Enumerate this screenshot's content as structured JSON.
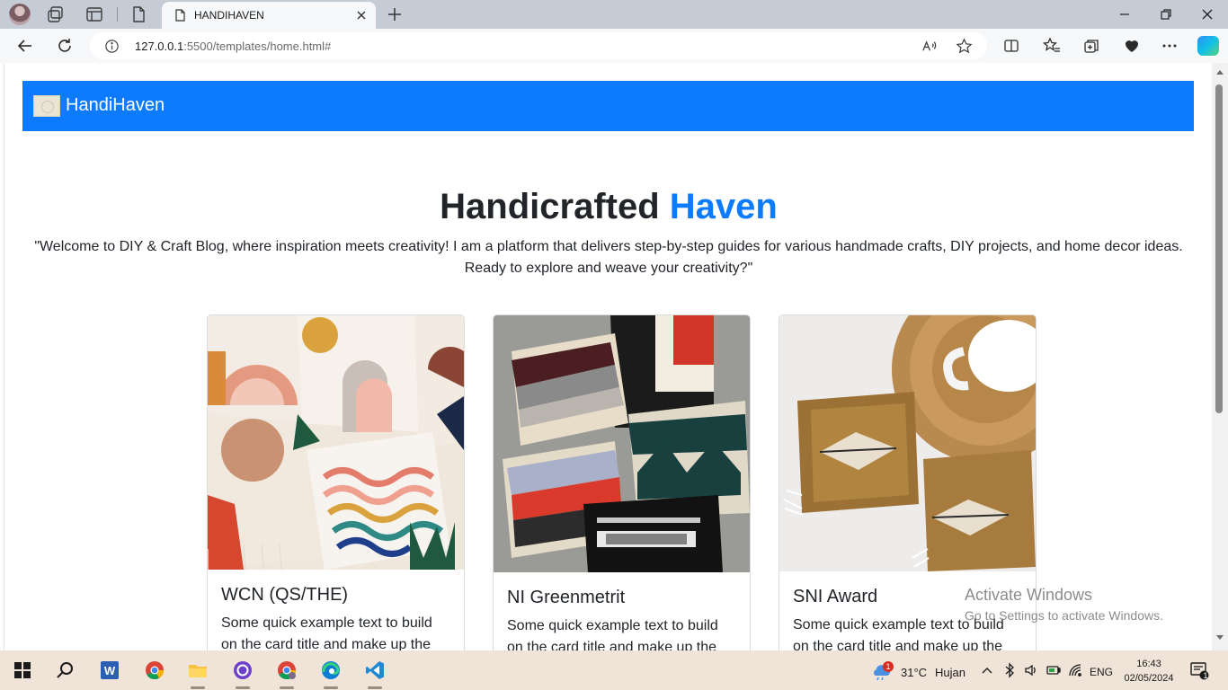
{
  "browser": {
    "tab_title": "HANDIHAVEN",
    "url_host": "127.0.0.1",
    "url_path": ":5500/templates/home.html#"
  },
  "page": {
    "brand": "HandiHaven",
    "hero_title_main": "Handicrafted",
    "hero_title_accent": "Haven",
    "hero_text": "\"Welcome to DIY & Craft Blog, where inspiration meets creativity! I am a platform that delivers step-by-step guides for various handmade crafts, DIY projects, and home decor ideas. Ready to explore and weave your creativity?\"",
    "cards": [
      {
        "title": "WCN (QS/THE)",
        "text": "Some quick example text to build on the card title and make up the bulk of the card's content."
      },
      {
        "title": "NI Greenmetrit",
        "text": "Some quick example text to build on the card title and make up the bulk of the card's content."
      },
      {
        "title": "SNI Award",
        "text": "Some quick example text to build on the card title and make up the bulk of the card's content."
      }
    ]
  },
  "watermark": {
    "line1": "Activate Windows",
    "line2": "Go to Settings to activate Windows."
  },
  "taskbar": {
    "weather_temp": "31°C",
    "weather_desc": "Hujan",
    "weather_badge": "1",
    "language": "ENG",
    "time": "16:43",
    "date": "02/05/2024",
    "notif_count": "1"
  },
  "colors": {
    "brand_blue": "#0d7bfd",
    "text": "#212529",
    "taskbar": "#f0e3d8"
  }
}
